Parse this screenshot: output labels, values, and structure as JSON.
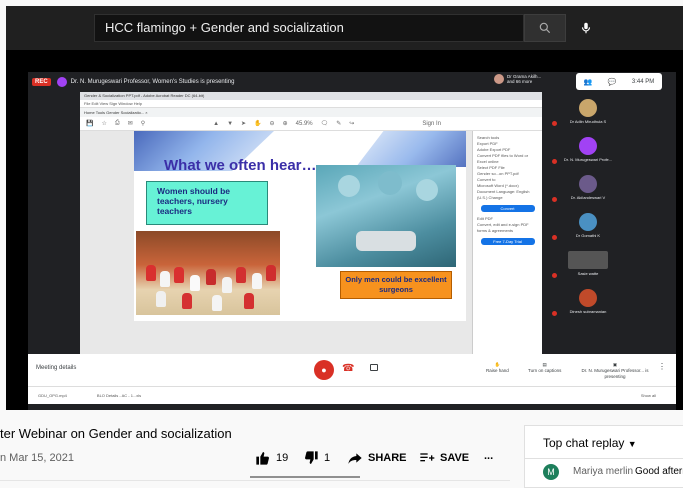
{
  "search": {
    "query": "HCC flamingo + Gender and socialization"
  },
  "meet": {
    "rec_label": "REC",
    "presenting_text": "Dr. N. Murugeswari Professor, Women's Studies is presenting",
    "host_name": "Dr Grama Akilh... and 66 more",
    "clock": "3:44 PM",
    "meeting_details_label": "Meeting details",
    "raise_hand_label": "Raise hand",
    "captions_label": "Turn on captions",
    "presenter_label": "Dr. N. Murugeswari Professor... is presenting",
    "participants": [
      {
        "name": "Dr Adlin Mirudhula S",
        "color": "#c9a66b"
      },
      {
        "name": "Dr. N. Murugeswari Profe...",
        "color": "#a142f4"
      },
      {
        "name": "Dr. Akilandeswari V",
        "color": "#6b5a8a"
      },
      {
        "name": "Dr Gomathi K",
        "color": "#4a90c2"
      },
      {
        "name": "Sasie watte",
        "color": "#555555"
      },
      {
        "name": "Dinesh subramanian",
        "color": "#c04a2a"
      }
    ]
  },
  "pdf": {
    "window_title": "Gender & Socialization PPT.pdf - Adobe Acrobat Reader DC (64-bit)",
    "menu": "File  Edit  View  Sign  Window  Help",
    "tabs": "Home   Tools   Gender Socializatio...  ×",
    "zoom": "45.9%",
    "sign_in": "Sign In",
    "panel_lines": [
      "Search tools",
      "Export PDF",
      "Adobe Export PDF",
      "Convert PDF files to Word or Excel online",
      "Select PDF File",
      "Gender so...on PPT.pdf",
      "Convert to",
      "Microsoft Word (*.docx)",
      "Document Language: English (U.S.) Change",
      "Convert",
      "Edit PDF",
      "Convert, edit and e-sign PDF forms & agreements",
      "Free 7-Day Trial"
    ]
  },
  "slide": {
    "title": "What we often hear…",
    "teal_box": "Women      should be        teachers, nursery teachers",
    "orange_box": "Only men could be excellent surgeons"
  },
  "taskbar": {
    "item1": "GDU_OPG.mp4",
    "item2": "BLO Details - AC - 1...xls",
    "show_all": "Show all"
  },
  "video": {
    "title": "ter Webinar on Gender and socialization",
    "date": "n Mar 15, 2021",
    "likes": "19",
    "dislikes": "1",
    "share_label": "SHARE",
    "save_label": "SAVE",
    "more_label": "..."
  },
  "chat": {
    "header": "Top chat replay",
    "avatar_letter": "M",
    "author": "Mariya merlin",
    "message": "Good afternoon"
  }
}
